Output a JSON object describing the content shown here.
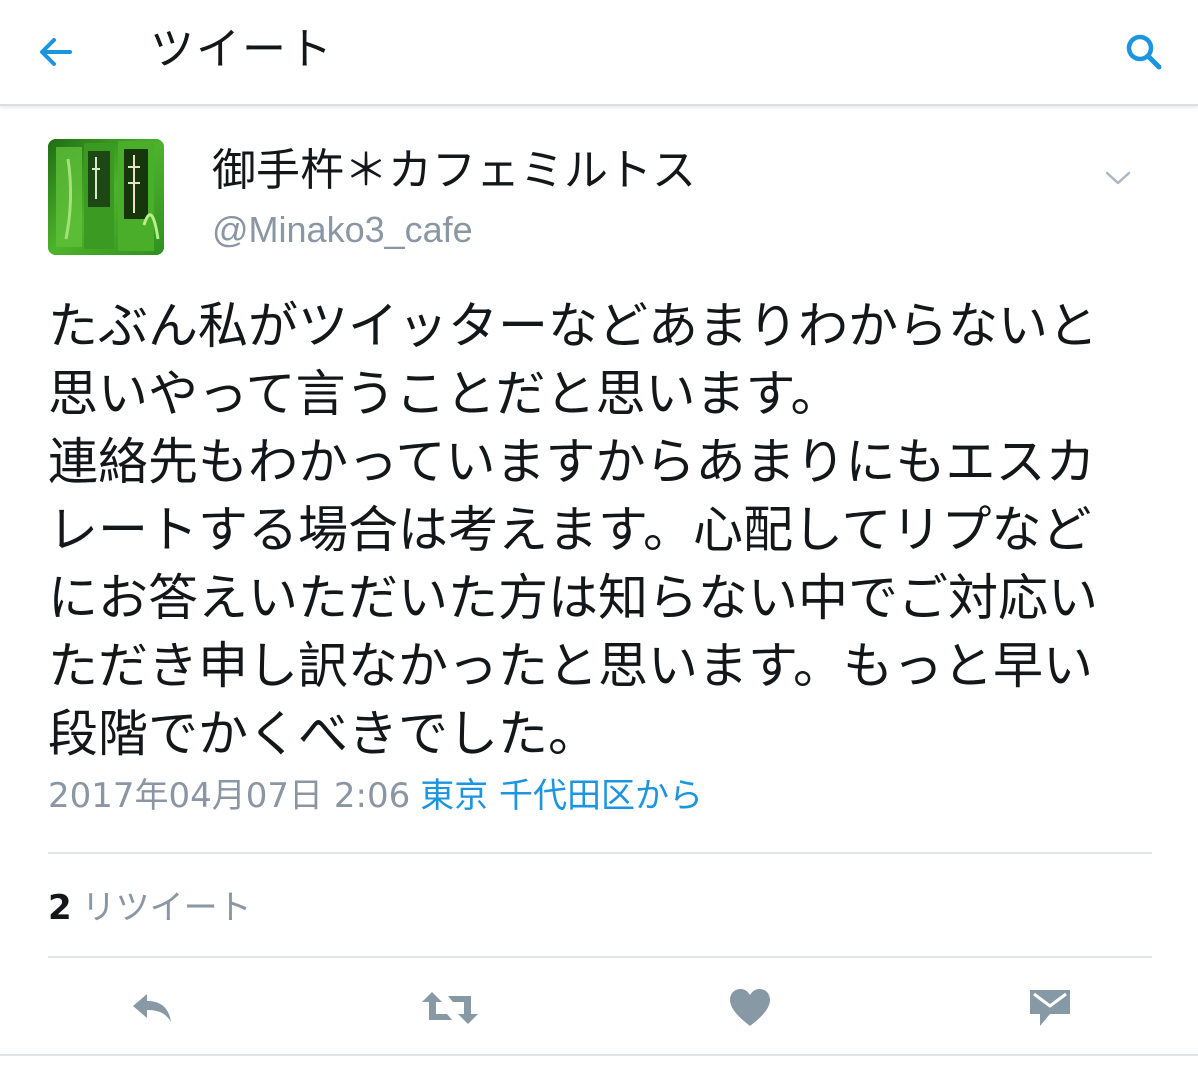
{
  "header": {
    "title": "ツイート",
    "back_icon": "arrow-left-icon",
    "search_icon": "search-icon",
    "accent_color": "#1b95e0"
  },
  "tweet": {
    "author": {
      "display_name": "御手杵＊カフェミルトス",
      "handle": "@Minako3_cafe",
      "avatar_icon": "green-tea-package-avatar"
    },
    "menu_icon": "chevron-down-icon",
    "text_lines": [
      "たぶん私がツイッターなどあまりわからないと",
      "思いやって言うことだと思います。",
      "連絡先もわかっていますからあまりにもエスカ",
      "レートする場合は考えます。心配してリプなど",
      "にお答えいただいた方は知らない中でご対応い",
      "ただき申し訳なかったと思います。もっと早い",
      "段階でかくべきでした。"
    ],
    "timestamp": "2017年04月07日 2:06",
    "location": "東京 千代田区から",
    "retweet_count": "2",
    "retweet_label": "リツイート"
  },
  "actions": [
    {
      "name": "reply",
      "icon": "reply-icon"
    },
    {
      "name": "retweet",
      "icon": "retweet-icon"
    },
    {
      "name": "like",
      "icon": "heart-icon"
    },
    {
      "name": "direct-message",
      "icon": "envelope-icon"
    }
  ],
  "colors": {
    "text": "#14171a",
    "secondary": "#8a96a3",
    "link": "#1b95e0",
    "action_icon": "#8899a6"
  }
}
